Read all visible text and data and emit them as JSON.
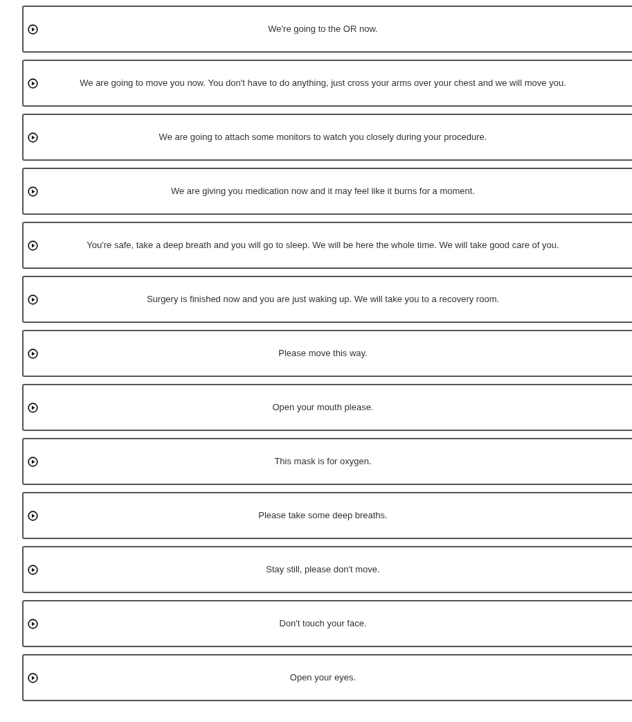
{
  "phrases": [
    {
      "text": "We're going to the OR now."
    },
    {
      "text": "We are going to move you now. You don't have to do anything, just cross your arms over your chest and we will move you."
    },
    {
      "text": "We are going to attach some monitors to watch you closely during your procedure."
    },
    {
      "text": "We are giving you medication now and it may feel like it burns for a moment."
    },
    {
      "text": "You're safe, take a deep breath and you will go to sleep. We will be here the whole time. We will take good care of you."
    },
    {
      "text": "Surgery is finished now and you are just waking up. We will take you to a recovery room."
    },
    {
      "text": "Please move this way."
    },
    {
      "text": "Open your mouth please."
    },
    {
      "text": "This mask is for oxygen."
    },
    {
      "text": "Please take some deep breaths."
    },
    {
      "text": "Stay still, please don't move."
    },
    {
      "text": "Don't touch your face."
    },
    {
      "text": "Open your eyes."
    }
  ]
}
